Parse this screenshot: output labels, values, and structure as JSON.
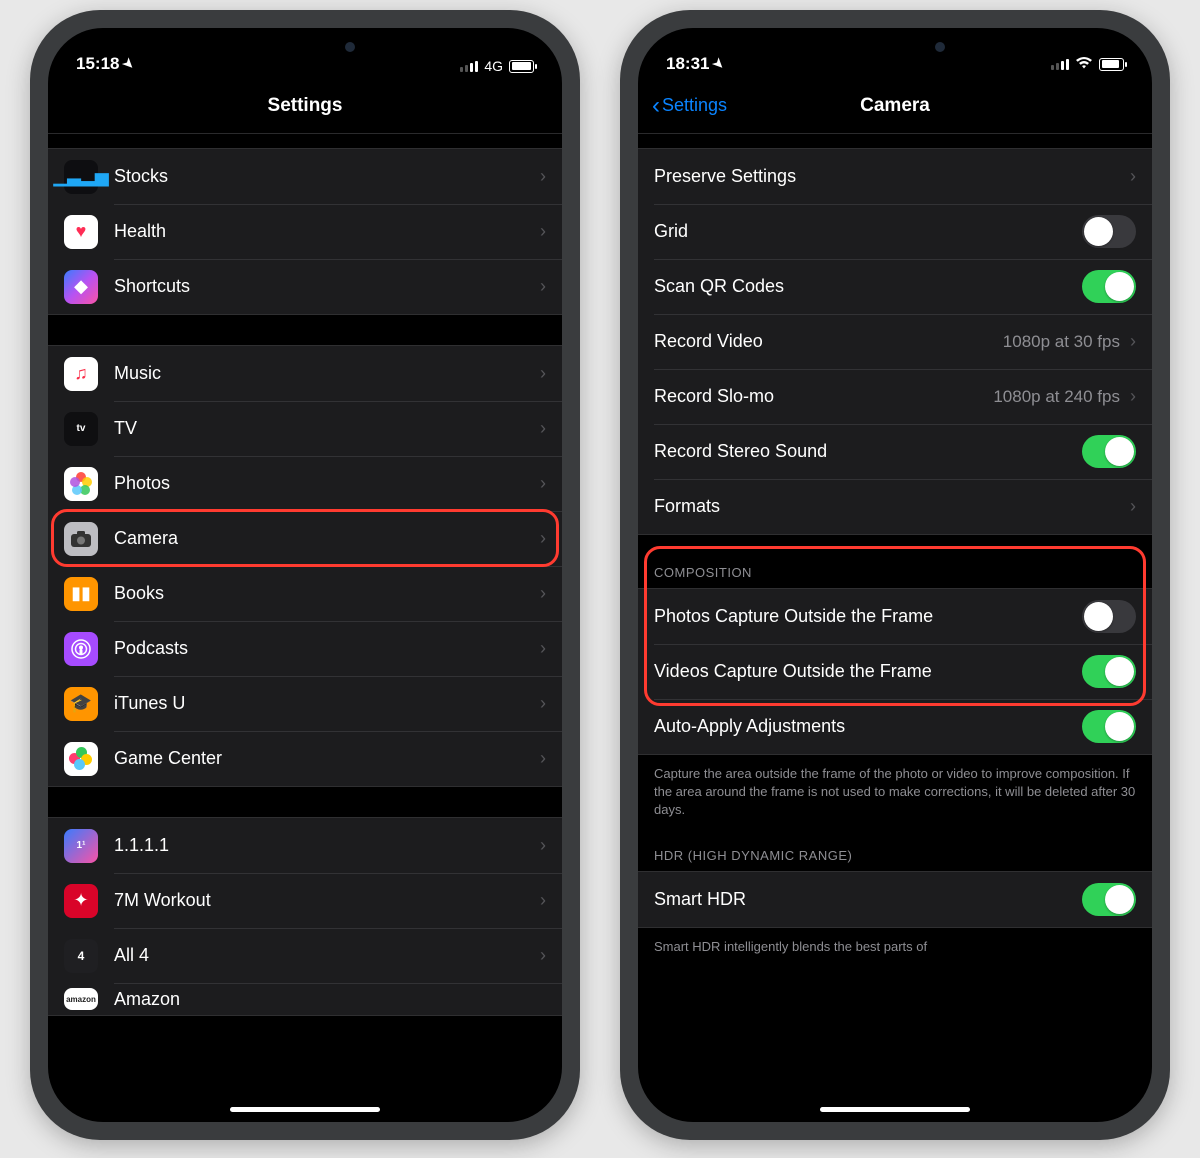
{
  "left": {
    "status": {
      "time": "15:18",
      "net": "4G"
    },
    "title": "Settings",
    "groups": [
      {
        "items": [
          {
            "label": "Stocks"
          },
          {
            "label": "Health"
          },
          {
            "label": "Shortcuts"
          }
        ]
      },
      {
        "items": [
          {
            "label": "Music"
          },
          {
            "label": "TV"
          },
          {
            "label": "Photos"
          },
          {
            "label": "Camera",
            "highlighted": true
          },
          {
            "label": "Books"
          },
          {
            "label": "Podcasts"
          },
          {
            "label": "iTunes U"
          },
          {
            "label": "Game Center"
          }
        ]
      },
      {
        "items": [
          {
            "label": "1.1.1.1"
          },
          {
            "label": "7M Workout"
          },
          {
            "label": "All 4"
          },
          {
            "label": "Amazon"
          }
        ]
      }
    ]
  },
  "right": {
    "status": {
      "time": "18:31"
    },
    "back": "Settings",
    "title": "Camera",
    "sections": {
      "main": [
        {
          "label": "Preserve Settings",
          "type": "link"
        },
        {
          "label": "Grid",
          "type": "toggle",
          "on": false
        },
        {
          "label": "Scan QR Codes",
          "type": "toggle",
          "on": true
        },
        {
          "label": "Record Video",
          "type": "link",
          "detail": "1080p at 30 fps"
        },
        {
          "label": "Record Slo-mo",
          "type": "link",
          "detail": "1080p at 240 fps"
        },
        {
          "label": "Record Stereo Sound",
          "type": "toggle",
          "on": true
        },
        {
          "label": "Formats",
          "type": "link"
        }
      ],
      "composition_header": "COMPOSITION",
      "composition": [
        {
          "label": "Photos Capture Outside the Frame",
          "type": "toggle",
          "on": false
        },
        {
          "label": "Videos Capture Outside the Frame",
          "type": "toggle",
          "on": true
        },
        {
          "label": "Auto-Apply Adjustments",
          "type": "toggle",
          "on": true
        }
      ],
      "composition_footer": "Capture the area outside the frame of the photo or video to improve composition. If the area around the frame is not used to make corrections, it will be deleted after 30 days.",
      "hdr_header": "HDR (HIGH DYNAMIC RANGE)",
      "hdr": [
        {
          "label": "Smart HDR",
          "type": "toggle",
          "on": true
        }
      ],
      "hdr_footer": "Smart HDR intelligently blends the best parts of"
    }
  }
}
